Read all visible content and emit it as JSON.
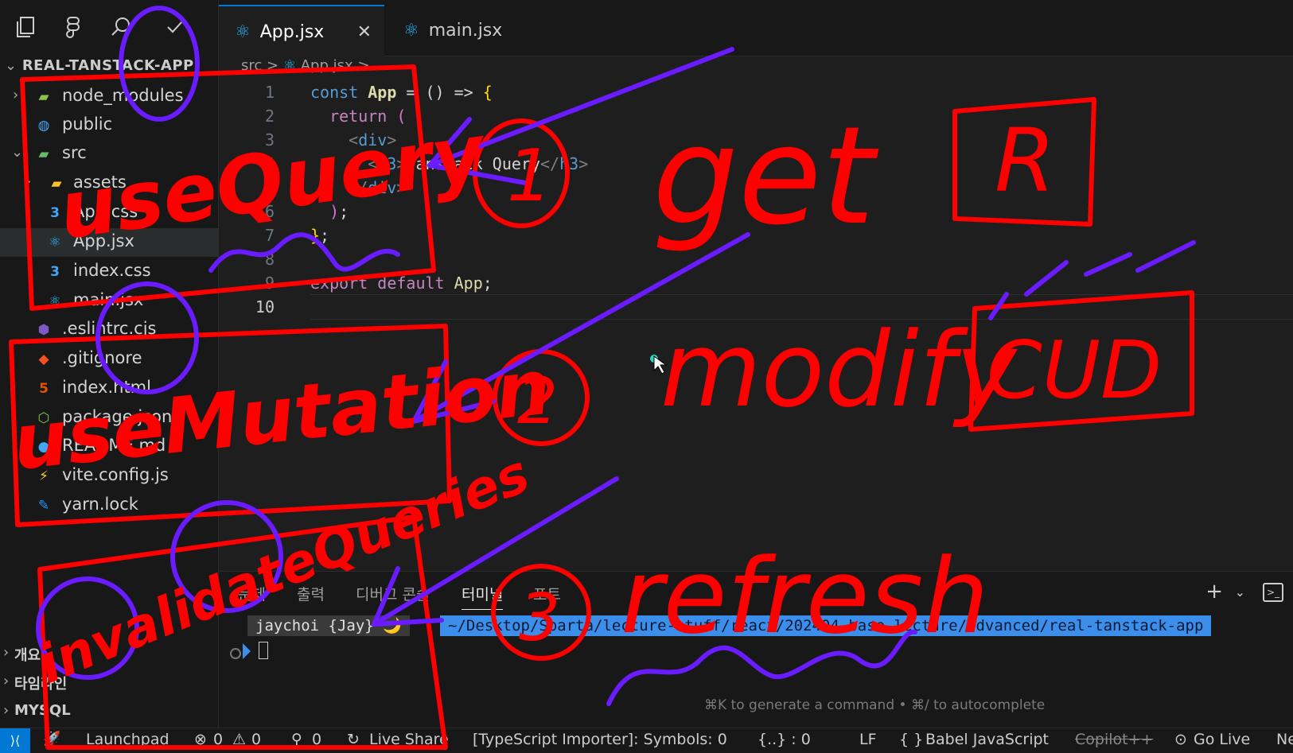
{
  "explorer": {
    "project_title": "REAL-TANSTACK-APP",
    "items": [
      {
        "label": "node_modules",
        "icon": "folder-node-icon"
      },
      {
        "label": "public",
        "icon": "folder-public-icon"
      },
      {
        "label": "src",
        "icon": "folder-src-icon"
      },
      {
        "label": "assets",
        "icon": "folder-assets-icon"
      },
      {
        "label": "App.css",
        "icon": "css-file-icon"
      },
      {
        "label": "App.jsx",
        "icon": "react-file-icon"
      },
      {
        "label": "index.css",
        "icon": "css-file-icon"
      },
      {
        "label": "main.jsx",
        "icon": "react-file-icon"
      },
      {
        "label": ".eslintrc.cjs",
        "icon": "eslint-file-icon"
      },
      {
        "label": ".gitignore",
        "icon": "git-file-icon"
      },
      {
        "label": "index.html",
        "icon": "html-file-icon"
      },
      {
        "label": "package.json",
        "icon": "json-file-icon"
      },
      {
        "label": "README.md",
        "icon": "info-file-icon"
      },
      {
        "label": "vite.config.js",
        "icon": "vite-file-icon"
      },
      {
        "label": "yarn.lock",
        "icon": "yarn-file-icon"
      }
    ],
    "bottom_sections": [
      "개요",
      "타임라인",
      "MYSQL"
    ]
  },
  "tabs": [
    {
      "label": "App.jsx",
      "active": true
    },
    {
      "label": "main.jsx",
      "active": false
    }
  ],
  "breadcrumb": {
    "part1": "src",
    "sep": ">",
    "part2": "App.jsx",
    "part3": "..."
  },
  "editor": {
    "line_numbers": [
      "1",
      "2",
      "3",
      "4",
      "5",
      "6",
      "7",
      "8",
      "9",
      "10"
    ],
    "lines": [
      {
        "a": "const ",
        "b": "App",
        "c": " = () => ",
        "d": "{"
      },
      {
        "a": "  return ",
        "b": "("
      },
      {
        "a": "    <",
        "b": "div",
        "c": ">"
      },
      {
        "a": "      <",
        "b": "h3",
        "c": ">",
        "d": "Tanstack Query",
        "e": "</",
        "f": "h3",
        "g": ">"
      },
      {
        "a": "    </",
        "b": "div",
        "c": ">"
      },
      {
        "a": "  ",
        "b": ")",
        "c": ";"
      },
      {
        "a": "",
        "b": "}",
        "c": ";"
      },
      {
        "a": ""
      },
      {
        "a": "export default ",
        "b": "App",
        "c": ";"
      },
      {
        "a": ""
      }
    ]
  },
  "panel": {
    "tabs": [
      "문제",
      "출력",
      "디버그 콘솔",
      "터미널",
      "포트"
    ],
    "active_tab": "터미널",
    "prompt_user": "jaychoi {Jay} 🌙",
    "prompt_path": "~/Desktop/Sparta/lecture-stuff/react/202404-base-lecture/advanced/real-tanstack-app",
    "hint": "⌘K to generate a command • ⌘/ to autocomplete"
  },
  "statusbar": {
    "launchpad": "Launchpad",
    "errors": "0",
    "warnings": "0",
    "ports": "0",
    "live_share": "Live Share",
    "ts_importer": "[TypeScript Importer]: Symbols: 0",
    "braces": "{..} : 0",
    "eol": "LF",
    "language": "Babel JavaScript",
    "copilot": "Copilot++",
    "go_live": "Go Live",
    "trailing": "Ne"
  },
  "annotations": {
    "hook1": "useQuery",
    "num1": "1",
    "word1": "get",
    "letter1": "R",
    "hook2": "useMutation",
    "num2": "2",
    "word2": "modify",
    "letters2": "CUD",
    "hook3": "invalidateQueries",
    "num3": "3",
    "word3": "refresh"
  },
  "colors": {
    "accent": "#0078d4",
    "ink_red": "#ff0000",
    "ink_purple": "#6a1bff"
  }
}
